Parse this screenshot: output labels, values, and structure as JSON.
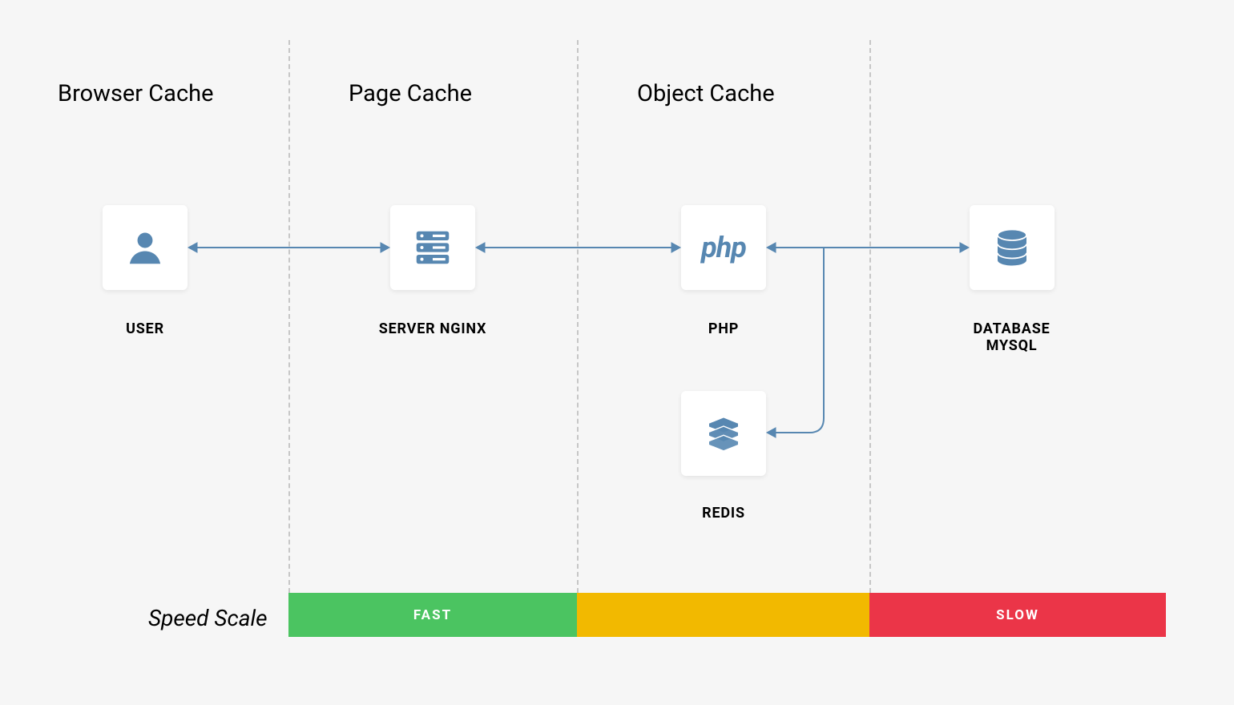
{
  "sections": {
    "browser": "Browser Cache",
    "page": "Page Cache",
    "object": "Object Cache"
  },
  "nodes": {
    "user": {
      "label": "USER"
    },
    "server": {
      "label": "SERVER NGINX"
    },
    "php": {
      "label": "PHP",
      "icon_text": "php"
    },
    "database": {
      "label": "DATABASE MYSQL"
    },
    "redis": {
      "label": "REDIS"
    }
  },
  "speed": {
    "title": "Speed Scale",
    "fast": "FAST",
    "slow": "SLOW"
  },
  "colors": {
    "icon": "#5787b1",
    "green": "#4bc461",
    "yellow": "#f2b900",
    "red": "#eb3548"
  }
}
